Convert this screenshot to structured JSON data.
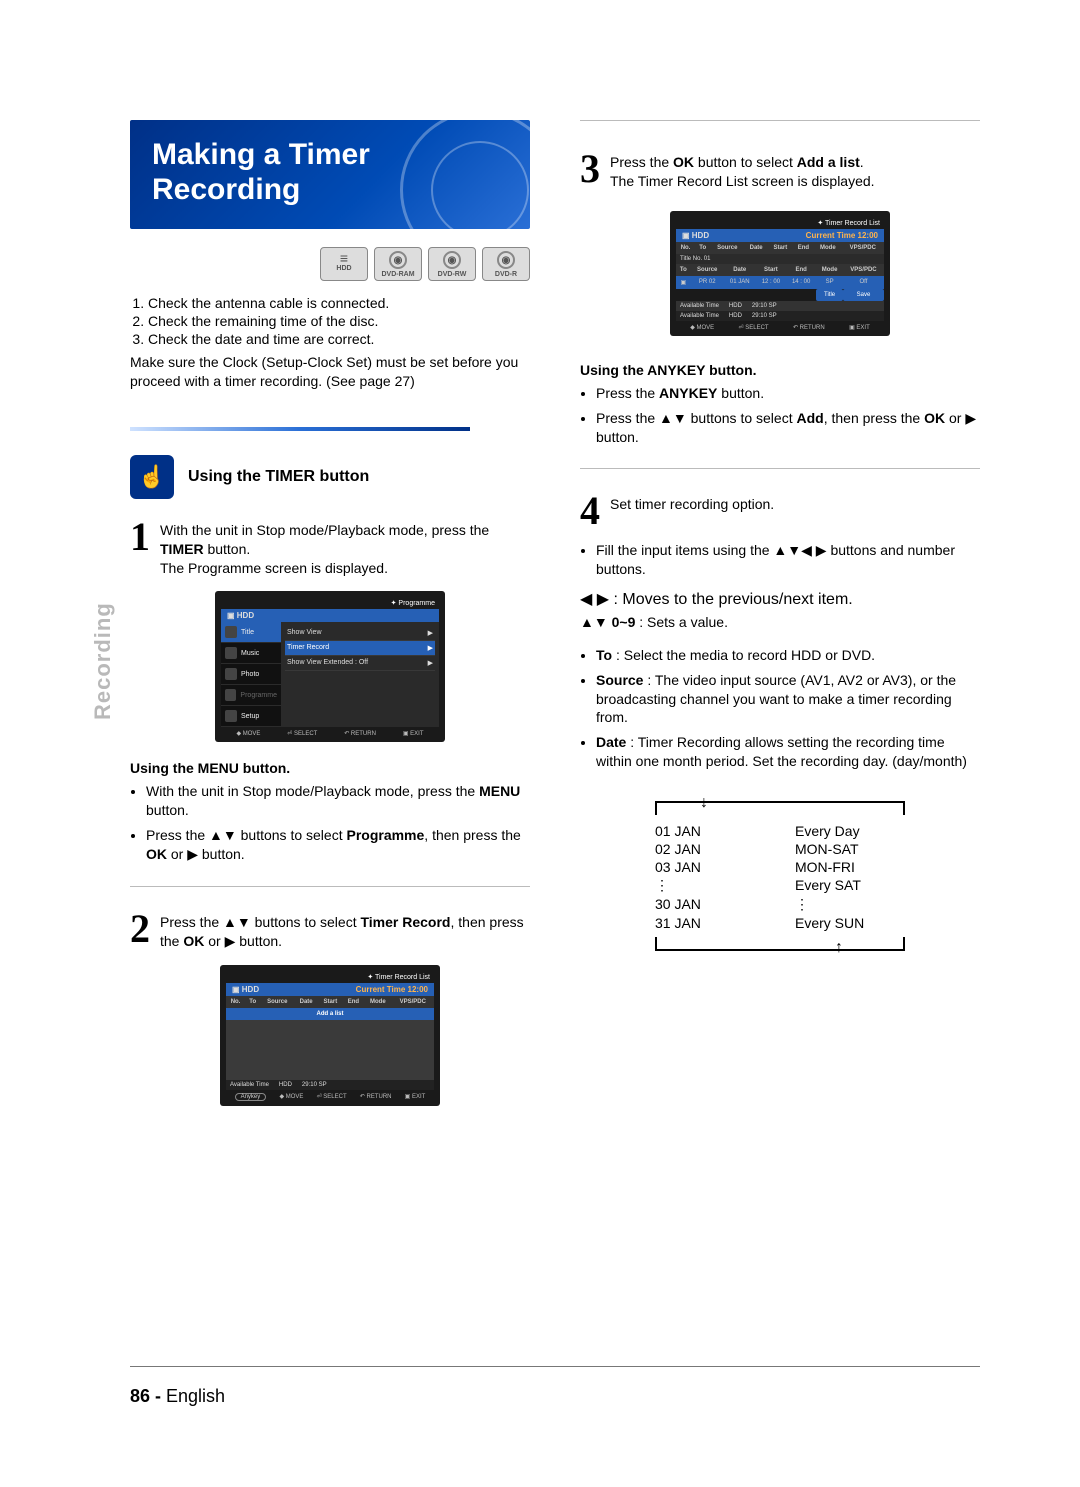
{
  "title": "Making a Timer Recording",
  "media": {
    "hdd": "HDD",
    "dvdram": "DVD-RAM",
    "dvdrw": "DVD-RW",
    "dvdr": "DVD-R"
  },
  "checks": {
    "1": "Check the antenna cable is connected.",
    "2": "Check the remaining time of the disc.",
    "3": "Check the date and time are correct."
  },
  "clock_note": "Make sure the Clock (Setup-Clock Set) must be set before you proceed with a timer recording. (See page 27)",
  "timer_heading": "Using the TIMER button",
  "step1": {
    "a": "With the unit in Stop mode/Playback mode, press the ",
    "timer": "TIMER",
    "b": " button.",
    "c": "The Programme screen is displayed."
  },
  "menu_heading": "Using the MENU button.",
  "bullets1": {
    "a_pre": "With the unit in Stop mode/Playback mode, press the ",
    "a_bold": "MENU",
    "a_post": " button.",
    "b_pre": "Press the ▲▼ buttons to select ",
    "b_bold": "Programme",
    "b_post": ", then press the ",
    "b_ok": "OK",
    "b_or": " or ▶ button."
  },
  "step2": {
    "a": "Press the ▲▼ buttons to select ",
    "b": "Timer Record",
    "c": ", then press the ",
    "d": "OK",
    "e": " or ▶ button."
  },
  "step3": {
    "a": "Press the ",
    "ok": "OK",
    "b": " button to select ",
    "add": "Add a list",
    "c": ".",
    "d": "The Timer Record List screen is displayed."
  },
  "anykey_heading": "Using the ANYKEY button.",
  "bullets2": {
    "a_pre": "Press the ",
    "a_bold": "ANYKEY",
    "a_post": " button.",
    "b_pre": "Press the ▲▼ buttons to select ",
    "b_bold": "Add",
    "b_post": ", then press the ",
    "b_ok": "OK",
    "b_or": " or ▶ button."
  },
  "step4": {
    "a": "Set timer recording option.",
    "b": "Fill the input items using the ▲▼◀ ▶ buttons and number buttons.",
    "nav1": "◀ ▶ : Moves to the previous/next item.",
    "nav2": "▲▼ 0~9",
    "nav2b": " : Sets a value.",
    "to_label": "To",
    "to_text": " : Select the media to record HDD or DVD.",
    "src_label": "Source",
    "src_text": " : The video input source (AV1, AV2 or AV3), or the broadcasting channel you want to make a timer recording from.",
    "date_label": "Date",
    "date_text": " : Timer Recording allows setting the recording time within one month period. Set the recording day. (day/month)"
  },
  "osd1": {
    "title": "Programme",
    "hdd": "HDD",
    "nav_title": "Title",
    "nav_music": "Music",
    "nav_photo": "Photo",
    "nav_prog": "Programme",
    "nav_setup": "Setup",
    "r1": "Show View",
    "r2": "Timer Record",
    "r3": "Show View Extended : Off",
    "f1": "MOVE",
    "f2": "SELECT",
    "f3": "RETURN",
    "f4": "EXIT"
  },
  "osd2": {
    "title": "Timer Record List",
    "hdd": "HDD",
    "cur": "Current Time 12:00",
    "h_no": "No.",
    "h_to": "To",
    "h_src": "Source",
    "h_date": "Date",
    "h_start": "Start",
    "h_end": "End",
    "h_mode": "Mode",
    "h_vps": "VPS/PDC",
    "add": "Add a list",
    "avail": "Available Time",
    "avail_hdd": "HDD",
    "avail_time": "29:10 SP",
    "anykey": "Anykey",
    "f1": "MOVE",
    "f2": "SELECT",
    "f3": "RETURN",
    "f4": "EXIT"
  },
  "osd3": {
    "title": "Timer Record List",
    "hdd": "HDD",
    "cur": "Current Time 12:00",
    "h_no": "No.",
    "h_to": "To",
    "h_src": "Source",
    "h_date": "Date",
    "h_start": "Start",
    "h_end": "End",
    "h_mode": "Mode",
    "h_vps": "VPS/PDC",
    "titleno": "Title No. 01",
    "row_src": "PR 02",
    "row_date": "01 JAN",
    "row_start": "12 : 00",
    "row_end": "14 : 00",
    "row_mode": "SP",
    "row_vps": "Off",
    "btn_title": "Title",
    "btn_save": "Save",
    "avail": "Available Time",
    "avail_hdd": "HDD",
    "avail_time": "29:10 SP",
    "f1": "MOVE",
    "f2": "SELECT",
    "f3": "RETURN",
    "f4": "EXIT"
  },
  "dates": {
    "l1": "01 JAN",
    "l2": "02 JAN",
    "l3": "03 JAN",
    "l4": "30 JAN",
    "l5": "31 JAN",
    "r1": "Every Day",
    "r2": "MON-SAT",
    "r3": "MON-FRI",
    "r4": "Every SAT",
    "r5": "Every SUN"
  },
  "side_label": "Recording",
  "footer": {
    "page": "86 - ",
    "lang": "English"
  }
}
